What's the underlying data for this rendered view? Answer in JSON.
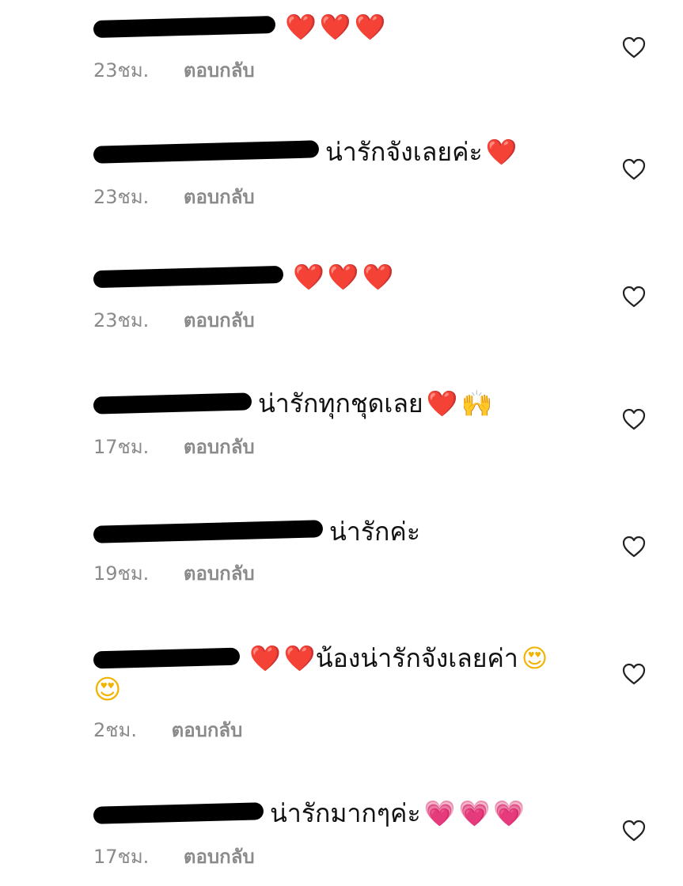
{
  "comments": [
    {
      "text": "",
      "emojis": [
        "❤️",
        "❤️",
        "❤️"
      ],
      "time": "23ชม.",
      "reply": "ตอบกลับ"
    },
    {
      "text": "น่ารักจังเลยค่ะ",
      "emojis": [
        "❤️"
      ],
      "time": "23ชม.",
      "reply": "ตอบกลับ"
    },
    {
      "text": "",
      "emojis": [
        "❤️",
        "❤️",
        "❤️"
      ],
      "time": "23ชม.",
      "reply": "ตอบกลับ"
    },
    {
      "text": "น่ารักทุกชุดเลย",
      "emojis": [
        "❤️",
        "🙌"
      ],
      "time": "17ชม.",
      "reply": "ตอบกลับ"
    },
    {
      "text": "น่ารักค่ะ",
      "emojis": [],
      "time": "19ชม.",
      "reply": "ตอบกลับ"
    },
    {
      "text": "น้องน่ารักจังเลยค่า",
      "pre_emojis": [
        "❤️",
        "❤️"
      ],
      "emojis": [
        "😍"
      ],
      "second_line": "😍",
      "time": "2ชม.",
      "reply": "ตอบกลับ"
    },
    {
      "text": "น่ารักมากๆค่ะ",
      "emojis": [
        "💗",
        "💗",
        "💗"
      ],
      "time": "17ชม.",
      "reply": "ตอบกลับ"
    }
  ],
  "icons": {
    "like": "heart-outline-icon"
  },
  "colors": {
    "meta_text": "#8a8a8a",
    "redaction": "#000000"
  }
}
